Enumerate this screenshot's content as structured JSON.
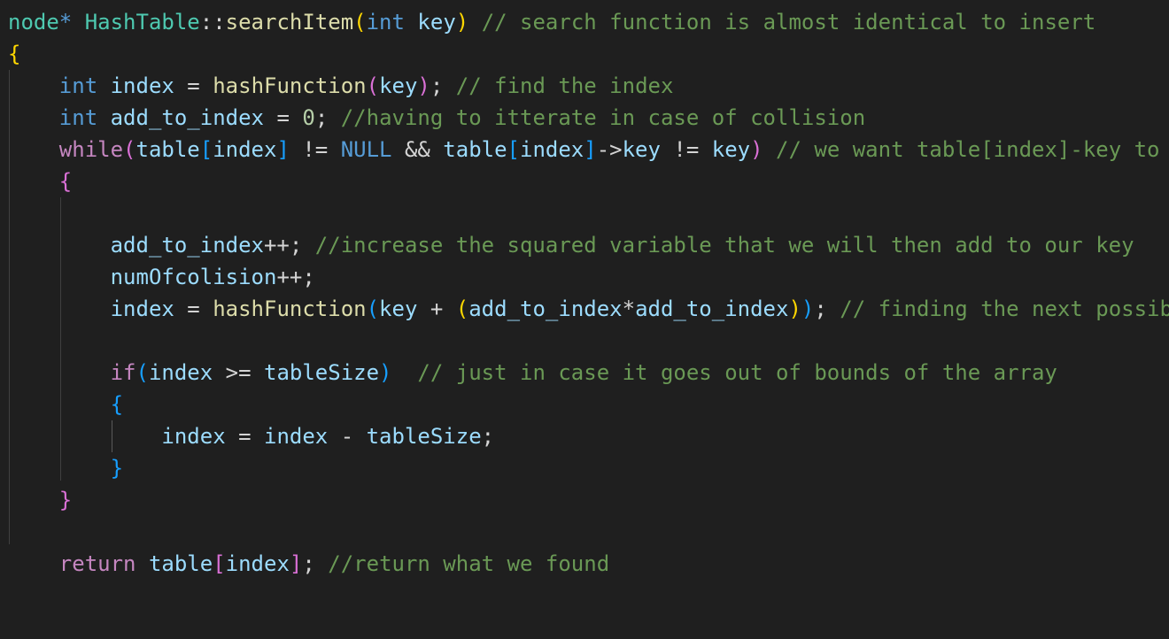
{
  "editor": {
    "lines": [
      [
        {
          "text": "node",
          "kind": "type"
        },
        {
          "text": "*",
          "kind": "keyword"
        },
        {
          "text": " ",
          "kind": "plain"
        },
        {
          "text": "HashTable",
          "kind": "type"
        },
        {
          "text": "::",
          "kind": "punct"
        },
        {
          "text": "searchItem",
          "kind": "function"
        },
        {
          "text": "(",
          "kind": "bracket1"
        },
        {
          "text": "int",
          "kind": "keyword"
        },
        {
          "text": " ",
          "kind": "plain"
        },
        {
          "text": "key",
          "kind": "variable"
        },
        {
          "text": ")",
          "kind": "bracket1"
        },
        {
          "text": " ",
          "kind": "plain"
        },
        {
          "text": "// search function is almost identical to insert",
          "kind": "comment"
        }
      ],
      [
        {
          "text": "{",
          "kind": "bracket1"
        }
      ],
      [
        {
          "text": "    ",
          "kind": "plain"
        },
        {
          "text": "int",
          "kind": "keyword"
        },
        {
          "text": " ",
          "kind": "plain"
        },
        {
          "text": "index",
          "kind": "variable"
        },
        {
          "text": " = ",
          "kind": "operator"
        },
        {
          "text": "hashFunction",
          "kind": "function"
        },
        {
          "text": "(",
          "kind": "bracket2"
        },
        {
          "text": "key",
          "kind": "variable"
        },
        {
          "text": ")",
          "kind": "bracket2"
        },
        {
          "text": "; ",
          "kind": "punct"
        },
        {
          "text": "// find the index",
          "kind": "comment"
        }
      ],
      [
        {
          "text": "    ",
          "kind": "plain"
        },
        {
          "text": "int",
          "kind": "keyword"
        },
        {
          "text": " ",
          "kind": "plain"
        },
        {
          "text": "add_to_index",
          "kind": "variable"
        },
        {
          "text": " = ",
          "kind": "operator"
        },
        {
          "text": "0",
          "kind": "number"
        },
        {
          "text": "; ",
          "kind": "punct"
        },
        {
          "text": "//having to itterate in case of collision",
          "kind": "comment"
        }
      ],
      [
        {
          "text": "    ",
          "kind": "plain"
        },
        {
          "text": "while",
          "kind": "control"
        },
        {
          "text": "(",
          "kind": "bracket2"
        },
        {
          "text": "table",
          "kind": "variable"
        },
        {
          "text": "[",
          "kind": "bracket3"
        },
        {
          "text": "index",
          "kind": "variable"
        },
        {
          "text": "]",
          "kind": "bracket3"
        },
        {
          "text": " != ",
          "kind": "operator"
        },
        {
          "text": "NULL",
          "kind": "constant"
        },
        {
          "text": " && ",
          "kind": "operator"
        },
        {
          "text": "table",
          "kind": "variable"
        },
        {
          "text": "[",
          "kind": "bracket3"
        },
        {
          "text": "index",
          "kind": "variable"
        },
        {
          "text": "]",
          "kind": "bracket3"
        },
        {
          "text": "->",
          "kind": "operator"
        },
        {
          "text": "key",
          "kind": "variable"
        },
        {
          "text": " != ",
          "kind": "operator"
        },
        {
          "text": "key",
          "kind": "variable"
        },
        {
          "text": ")",
          "kind": "bracket2"
        },
        {
          "text": " ",
          "kind": "plain"
        },
        {
          "text": "// we want table[index]-key to",
          "kind": "comment"
        }
      ],
      [
        {
          "text": "    ",
          "kind": "plain"
        },
        {
          "text": "{",
          "kind": "bracket2"
        }
      ],
      [
        {
          "text": "",
          "kind": "plain"
        }
      ],
      [
        {
          "text": "        ",
          "kind": "plain"
        },
        {
          "text": "add_to_index",
          "kind": "variable"
        },
        {
          "text": "++",
          "kind": "operator"
        },
        {
          "text": "; ",
          "kind": "punct"
        },
        {
          "text": "//increase the squared variable that we will then add to our key",
          "kind": "comment"
        }
      ],
      [
        {
          "text": "        ",
          "kind": "plain"
        },
        {
          "text": "numOfcolision",
          "kind": "variable"
        },
        {
          "text": "++",
          "kind": "operator"
        },
        {
          "text": ";",
          "kind": "punct"
        }
      ],
      [
        {
          "text": "        ",
          "kind": "plain"
        },
        {
          "text": "index",
          "kind": "variable"
        },
        {
          "text": " = ",
          "kind": "operator"
        },
        {
          "text": "hashFunction",
          "kind": "function"
        },
        {
          "text": "(",
          "kind": "bracket3"
        },
        {
          "text": "key",
          "kind": "variable"
        },
        {
          "text": " + ",
          "kind": "operator"
        },
        {
          "text": "(",
          "kind": "bracket1"
        },
        {
          "text": "add_to_index",
          "kind": "variable"
        },
        {
          "text": "*",
          "kind": "operator"
        },
        {
          "text": "add_to_index",
          "kind": "variable"
        },
        {
          "text": ")",
          "kind": "bracket1"
        },
        {
          "text": ")",
          "kind": "bracket3"
        },
        {
          "text": "; ",
          "kind": "punct"
        },
        {
          "text": "// finding the next possib",
          "kind": "comment"
        }
      ],
      [
        {
          "text": "",
          "kind": "plain"
        }
      ],
      [
        {
          "text": "        ",
          "kind": "plain"
        },
        {
          "text": "if",
          "kind": "control"
        },
        {
          "text": "(",
          "kind": "bracket3"
        },
        {
          "text": "index",
          "kind": "variable"
        },
        {
          "text": " >= ",
          "kind": "operator"
        },
        {
          "text": "tableSize",
          "kind": "variable"
        },
        {
          "text": ")",
          "kind": "bracket3"
        },
        {
          "text": "  ",
          "kind": "plain"
        },
        {
          "text": "// just in case it goes out of bounds of the array",
          "kind": "comment"
        }
      ],
      [
        {
          "text": "        ",
          "kind": "plain"
        },
        {
          "text": "{",
          "kind": "bracket3"
        }
      ],
      [
        {
          "text": "            ",
          "kind": "plain"
        },
        {
          "text": "index",
          "kind": "variable"
        },
        {
          "text": " = ",
          "kind": "operator"
        },
        {
          "text": "index",
          "kind": "variable"
        },
        {
          "text": " - ",
          "kind": "operator"
        },
        {
          "text": "tableSize",
          "kind": "variable"
        },
        {
          "text": ";",
          "kind": "punct"
        }
      ],
      [
        {
          "text": "        ",
          "kind": "plain"
        },
        {
          "text": "}",
          "kind": "bracket3"
        }
      ],
      [
        {
          "text": "    ",
          "kind": "plain"
        },
        {
          "text": "}",
          "kind": "bracket2"
        }
      ],
      [
        {
          "text": "",
          "kind": "plain"
        }
      ],
      [
        {
          "text": "    ",
          "kind": "plain"
        },
        {
          "text": "return",
          "kind": "control"
        },
        {
          "text": " ",
          "kind": "plain"
        },
        {
          "text": "table",
          "kind": "variable"
        },
        {
          "text": "[",
          "kind": "bracket2"
        },
        {
          "text": "index",
          "kind": "variable"
        },
        {
          "text": "]",
          "kind": "bracket2"
        },
        {
          "text": "; ",
          "kind": "punct"
        },
        {
          "text": "//return what we found",
          "kind": "comment"
        }
      ]
    ]
  },
  "colors": {
    "background": "#1f1f1f",
    "type": "#4ec9b0",
    "keyword": "#569cd6",
    "control": "#c586c0",
    "function": "#dcdcaa",
    "variable": "#9cdcfe",
    "number": "#b5cea8",
    "comment": "#6a9955",
    "bracket_level_1": "#ffd700",
    "bracket_level_2": "#da70d6",
    "bracket_level_3": "#179fff"
  }
}
